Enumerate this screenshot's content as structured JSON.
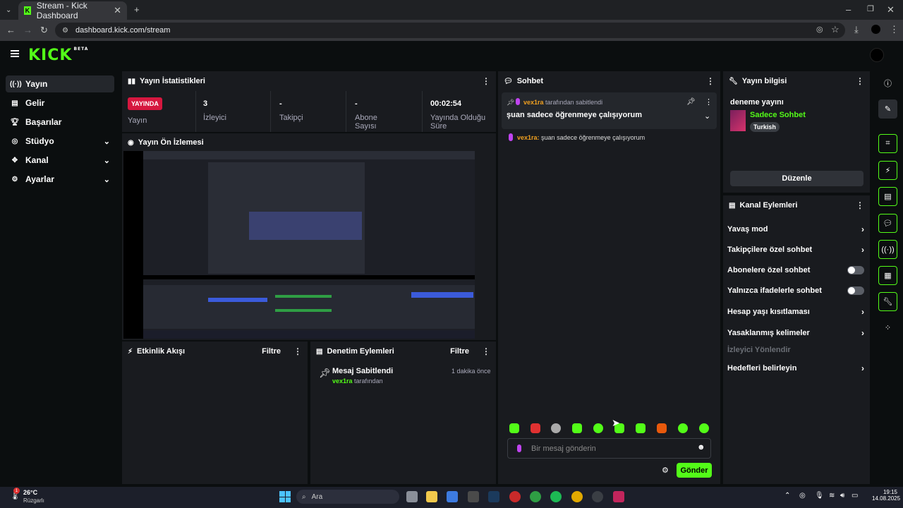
{
  "browser": {
    "tab_title": "Stream - Kick Dashboard",
    "url": "dashboard.kick.com/stream"
  },
  "brand": {
    "logo": "KICK",
    "beta": "BETA",
    "accent": "#53fc18"
  },
  "sidebar": {
    "items": [
      {
        "label": "Yayın",
        "icon": "broadcast-icon"
      },
      {
        "label": "Gelir",
        "icon": "revenue-icon"
      },
      {
        "label": "Başarılar",
        "icon": "trophy-icon"
      },
      {
        "label": "Stüdyo",
        "icon": "studio-icon"
      },
      {
        "label": "Kanal",
        "icon": "channel-icon"
      },
      {
        "label": "Ayarlar",
        "icon": "gear-icon"
      }
    ]
  },
  "stats": {
    "title": "Yayın İstatistikleri",
    "live_badge": "YAYINDA",
    "live_label": "Yayın",
    "viewers_value": "3",
    "viewers_label": "İzleyici",
    "followers_value": "-",
    "followers_label": "Takipçi",
    "subs_value": "-",
    "subs_label": "Abone Sayısı",
    "uptime_value": "00:02:54",
    "uptime_label_1": "Yayında Olduğu",
    "uptime_label_2": "Süre"
  },
  "preview": {
    "title": "Yayın Ön İzlemesi"
  },
  "activity": {
    "title": "Etkinlik Akışı",
    "filter": "Filtre"
  },
  "moderation": {
    "title": "Denetim Eylemleri",
    "filter": "Filtre",
    "entry_title": "Mesaj Sabitlendi",
    "entry_time": "1 dakika önce",
    "entry_user": "vex1ra",
    "entry_suffix": "tarafından"
  },
  "chat": {
    "title": "Sohbet",
    "pinned_user": "vex1ra",
    "pinned_suffix": "tarafından sabitlendi",
    "pinned_message": "şuan sadece öğrenmeye çalışıyorum",
    "message_user": "vex1ra:",
    "message_text": "şuan sadece öğrenmeye çalışıyorum",
    "input_placeholder": "Bir mesaj gönderin",
    "send_label": "Gönder"
  },
  "info": {
    "title": "Yayın bilgisi",
    "stream_title": "deneme yayını",
    "category": "Sadece Sohbet",
    "language": "Turkish",
    "edit_label": "Düzenle"
  },
  "channel_actions": {
    "title": "Kanal Eylemleri",
    "items": [
      {
        "label": "Yavaş mod"
      },
      {
        "label": "Takipçilere özel sohbet"
      },
      {
        "label": "Abonelere özel sohbet"
      },
      {
        "label": "Yalnızca ifadelerle sohbet"
      },
      {
        "label": "Hesap yaşı kısıtlaması"
      },
      {
        "label": "Yasaklanmış kelimeler"
      },
      {
        "label": "İzleyici Yönlendir"
      },
      {
        "label": "Hedefleri belirleyin"
      }
    ]
  },
  "taskbar": {
    "weather_temp": "26°C",
    "weather_desc": "Rüzgarlı",
    "weather_badge": "1",
    "search_label": "Ara",
    "time": "19:15",
    "date": "14.08.2025"
  }
}
